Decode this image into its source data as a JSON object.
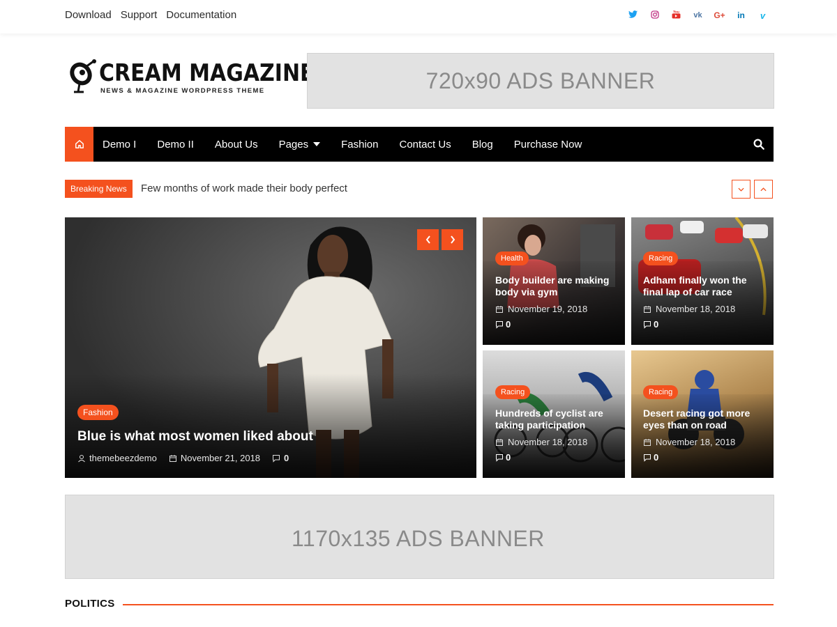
{
  "top_links": [
    "Download",
    "Support",
    "Documentation"
  ],
  "social_icons": [
    {
      "name": "twitter-icon",
      "glyph": "t",
      "color": "#1da1f2"
    },
    {
      "name": "instagram-icon",
      "glyph": "◎",
      "color": "#c13584"
    },
    {
      "name": "youtube-icon",
      "glyph": "▶",
      "color": "#e52d27"
    },
    {
      "name": "vk-icon",
      "glyph": "vk",
      "color": "#4c75a3"
    },
    {
      "name": "google-plus-icon",
      "glyph": "G+",
      "color": "#dd4b39"
    },
    {
      "name": "linkedin-icon",
      "glyph": "in",
      "color": "#0077b5"
    },
    {
      "name": "vimeo-icon",
      "glyph": "v",
      "color": "#1ab7ea"
    }
  ],
  "logo": {
    "title": "CREAM MAGAZINE",
    "subtitle": "NEWS & MAGAZINE WORDPRESS THEME"
  },
  "ads": {
    "top": "720x90 ADS BANNER",
    "bottom": "1170x135 ADS BANNER"
  },
  "nav": {
    "items": [
      "Demo I",
      "Demo II",
      "About Us",
      "Pages",
      "Fashion",
      "Contact Us",
      "Blog",
      "Purchase Now"
    ]
  },
  "breaking": {
    "label": "Breaking News",
    "text": "Few months of work made their body perfect"
  },
  "hero": {
    "category": "Fashion",
    "title": "Blue is what most women liked about",
    "author": "themebeezdemo",
    "date": "November 21, 2018",
    "comments": "0"
  },
  "cards": [
    {
      "category": "Health",
      "title": "Body builder are making body via gym",
      "date": "November 19, 2018",
      "comments": "0"
    },
    {
      "category": "Racing",
      "title": "Adham finally won the final lap of car race",
      "date": "November 18, 2018",
      "comments": "0"
    },
    {
      "category": "Racing",
      "title": "Hundreds of cyclist are taking participation",
      "date": "November 18, 2018",
      "comments": "0"
    },
    {
      "category": "Racing",
      "title": "Desert racing got more eyes than on road",
      "date": "November 18, 2018",
      "comments": "0"
    }
  ],
  "section": {
    "title": "POLITICS"
  },
  "colors": {
    "accent": "#f4511e",
    "nav_bg": "#000000",
    "ad_bg": "#e2e2e2"
  }
}
